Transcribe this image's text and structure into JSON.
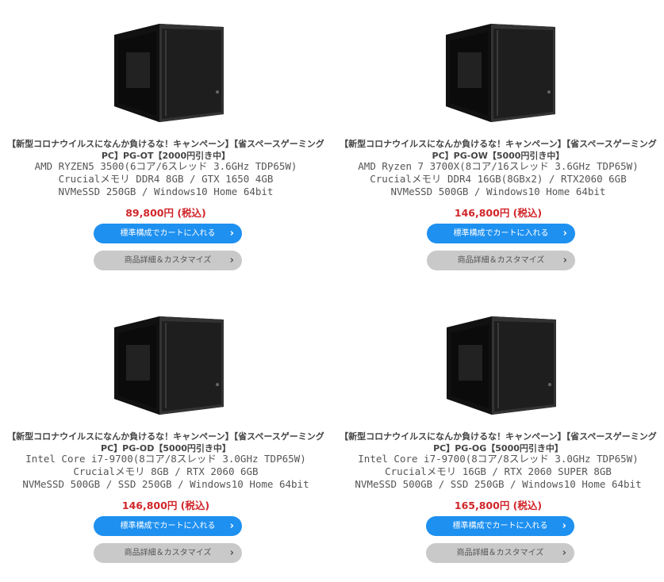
{
  "products": [
    {
      "title": "【新型コロナウイルスになんか負けるな！キャンペーン】【省スペースゲーミングPC】PG-OT【2000円引き中】",
      "specs": [
        "AMD RYZEN5 3500(6コア/6スレッド 3.6GHz TDP65W)",
        "Crucialメモリ DDR4 8GB / GTX 1650 4GB",
        "NVMeSSD 250GB / Windows10 Home 64bit"
      ],
      "price": "89,800円 (税込)",
      "cart_label": "標準構成でカートに入れる",
      "detail_label": "商品詳細＆カスタマイズ"
    },
    {
      "title": "【新型コロナウイルスになんか負けるな！キャンペーン】【省スペースゲーミングPC】PG-OW【5000円引き中】",
      "specs": [
        "AMD Ryzen 7 3700X(8コア/16スレッド 3.6GHz TDP65W)",
        "Crucialメモリ DDR4 16GB(8GBx2) / RTX2060 6GB",
        "NVMeSSD 500GB / Windows10 Home 64bit"
      ],
      "price": "146,800円 (税込)",
      "cart_label": "標準構成でカートに入れる",
      "detail_label": "商品詳細＆カスタマイズ"
    },
    {
      "title": "【新型コロナウイルスになんか負けるな！キャンペーン】【省スペースゲーミングPC】PG-OD【5000円引き中】",
      "specs": [
        "Intel Core i7-9700(8コア/8スレッド 3.0GHz TDP65W)",
        "Crucialメモリ 8GB / RTX 2060 6GB",
        "NVMeSSD 500GB / SSD 250GB / Windows10 Home 64bit"
      ],
      "price": "146,800円 (税込)",
      "cart_label": "標準構成でカートに入れる",
      "detail_label": "商品詳細＆カスタマイズ"
    },
    {
      "title": "【新型コロナウイルスになんか負けるな！キャンペーン】【省スペースゲーミングPC】PG-OG【5000円引き中】",
      "specs": [
        "Intel Core i7-9700(8コア/8スレッド 3.0GHz TDP65W)",
        "Crucialメモリ 16GB / RTX 2060 SUPER 8GB",
        "NVMeSSD 500GB / SSD 250GB / Windows10 Home 64bit"
      ],
      "price": "165,800円 (税込)",
      "cart_label": "標準構成でカートに入れる",
      "detail_label": "商品詳細＆カスタマイズ"
    }
  ],
  "icons": {
    "button_arrow": "chevron-right-icon"
  },
  "colors": {
    "price": "#d0262a",
    "cart_button": "#1e90f0",
    "detail_button": "#c9c9c9"
  }
}
